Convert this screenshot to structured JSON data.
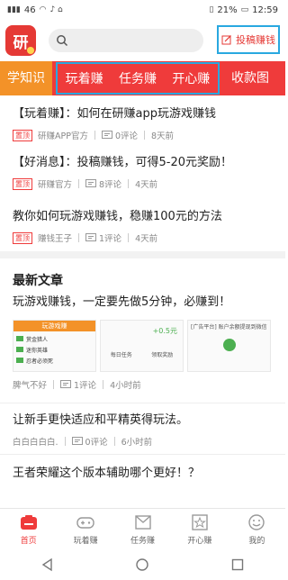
{
  "statusbar": {
    "signal": "46",
    "battery": "21%",
    "time": "12:59"
  },
  "header": {
    "search_placeholder": "",
    "submit_label": "投稿赚钱"
  },
  "tabs": {
    "first": "学知识",
    "group": [
      "玩着赚",
      "任务赚",
      "开心赚"
    ],
    "last": "收款图"
  },
  "feed": {
    "pinned": [
      {
        "title": "【玩着赚】：如何在研赚app玩游戏赚钱",
        "tag": "置顶",
        "author": "研赚APP官方",
        "comments": "0评论",
        "time": "8天前"
      },
      {
        "title": "【好消息】：投稿赚钱，可得5-20元奖励！",
        "tag": "置顶",
        "author": "研赚官方",
        "comments": "8评论",
        "time": "4天前"
      }
    ],
    "article1": {
      "title": "教你如何玩游戏赚钱，稳赚100元的方法",
      "tag": "置顶",
      "author": "赚钱王子",
      "comments": "1评论",
      "time": "4天前"
    },
    "section_title": "最新文章",
    "latest": [
      {
        "title": "玩游戏赚钱，一定要先做5分钟，必赚到！",
        "author": "脾气不好",
        "comments": "1评论",
        "time": "4小时前",
        "thumbs": [
          {
            "header": "玩游戏赚",
            "rows": [
              "赏金猎人",
              "迷你英雄",
              "忍者必须死"
            ]
          },
          {
            "amount": "+0.5元",
            "labels": [
              "每日任务",
              "领取奖励"
            ]
          },
          {
            "header": "[广告平台] 账户余额提现到微信"
          }
        ]
      },
      {
        "title": "让新手更快适应和平精英得玩法。",
        "author": "白白白白白.",
        "comments": "0评论",
        "time": "6小时前"
      },
      {
        "title": "王者荣耀这个版本辅助哪个更好！？"
      }
    ]
  },
  "bottomnav": {
    "items": [
      {
        "label": "首页",
        "icon": "home-icon"
      },
      {
        "label": "玩着赚",
        "icon": "gamepad-icon"
      },
      {
        "label": "任务赚",
        "icon": "envelope-icon"
      },
      {
        "label": "开心赚",
        "icon": "star-icon"
      },
      {
        "label": "我的",
        "icon": "smile-icon"
      }
    ]
  },
  "colors": {
    "brand_red": "#ef3b3b",
    "orange_tab": "#f39228",
    "highlight_blue": "#29a8e0"
  }
}
